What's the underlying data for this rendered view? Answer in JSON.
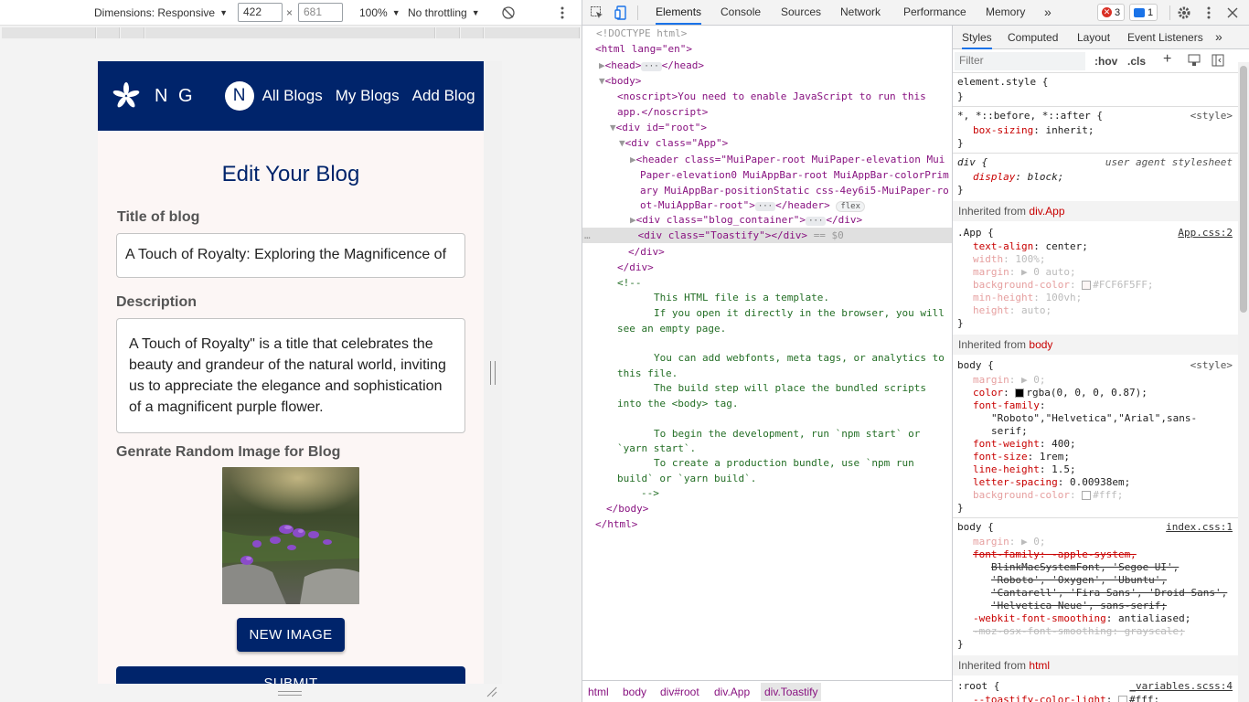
{
  "device_toolbar": {
    "dimensions_label": "Dimensions: Responsive",
    "width": "422",
    "height": "681",
    "zoom": "100%",
    "throttling": "No throttling",
    "times": "×"
  },
  "app": {
    "brand": "N G",
    "avatar_letter": "N",
    "nav": {
      "all": "All Blogs",
      "mine": "My Blogs",
      "add": "Add Blog"
    },
    "page_title": "Edit Your Blog",
    "title_label": "Title of blog",
    "title_value": "A Touch of Royalty: Exploring the Magnificence of",
    "description_label": "Description",
    "description_value": "A Touch of Royalty\" is a title that celebrates the beauty and grandeur of the natural world, inviting us to appreciate the elegance and sophistication of a magnificent purple flower.",
    "image_label": "Genrate Random Image for Blog",
    "new_image_button": "NEW IMAGE",
    "submit_button": "SUBMIT",
    "header_color": "#00246B",
    "background_color": "#FCF6F5"
  },
  "devtools": {
    "tabs": [
      "Elements",
      "Console",
      "Sources",
      "Network",
      "Performance",
      "Memory",
      "»"
    ],
    "errors_count": "3",
    "messages_count": "1"
  },
  "elements": {
    "lines": [
      "<!DOCTYPE html>",
      "<html lang=\"en\">",
      "<head>",
      "</head>",
      "<body>",
      "<noscript>You need to enable JavaScript to run this",
      "app.</noscript>",
      "<div id=\"root\">",
      "<div class=\"App\">",
      "<header class=\"MuiPaper-root MuiPaper-elevation Mui",
      "Paper-elevation0 MuiAppBar-root MuiAppBar-colorPrim",
      "ary MuiAppBar-positionStatic css-4ey6i5-MuiPaper-ro",
      "ot-MuiAppBar-root\">",
      "</header>",
      "flex",
      "<div class=\"blog_container\">",
      "</div>",
      "<div class=\"Toastify\"></div>",
      "== $0",
      "</div>",
      "</div>",
      "<!--",
      "This HTML file is a template.",
      "If you open it directly in the browser, you will",
      "see an empty page.",
      "You can add webfonts, meta tags, or analytics to",
      "this file.",
      "The build step will place the bundled scripts",
      "into the <body> tag.",
      "To begin the development, run `npm start` or",
      "`yarn start`.",
      "To create a production bundle, use `npm run",
      "build` or `yarn build`.",
      "-->",
      "</body>",
      "</html>"
    ],
    "ellipsis": "…",
    "dots": "···"
  },
  "breadcrumbs": [
    "html",
    "body",
    "div#root",
    "div.App",
    "div.Toastify"
  ],
  "styles": {
    "tabs": [
      "Styles",
      "Computed",
      "Layout",
      "Event Listeners",
      "»"
    ],
    "filter_placeholder": "Filter",
    "hov": ":hov",
    "cls": ".cls",
    "rules": {
      "element_style": "element.style {",
      "close": "}",
      "universal_selector": "*, *::before, *::after {",
      "universal_src": "<style>",
      "box_sizing": "box-sizing",
      "inherit": "inherit;",
      "div_selector": "div {",
      "div_src": "user agent stylesheet",
      "display": "display",
      "block": "block;",
      "inherited_from": "Inherited from",
      "div_app": "div.App",
      "app_selector": ".App {",
      "app_src": "App.css:2",
      "text_align": "text-align",
      "center": "center;",
      "width": "width",
      "width_val": "100%;",
      "margin": "margin",
      "margin_auto": "0 auto;",
      "background_color": "background-color",
      "bg_val": "#FCF6F5FF;",
      "min_height": "min-height",
      "min_height_val": "100vh;",
      "height": "height",
      "height_val": "auto;",
      "body_label": "body",
      "body_selector": "body {",
      "body_src": "<style>",
      "margin_zero": "0;",
      "color": "color",
      "color_val": "rgba(0, 0, 0, 0.87);",
      "font_family": "font-family",
      "font_family_val1": "\"Roboto\",\"Helvetica\",\"Arial\",sans-",
      "font_family_val2": "serif;",
      "font_weight": "font-weight",
      "font_weight_val": "400;",
      "font_size": "font-size",
      "font_size_val": "1rem;",
      "line_height": "line-height",
      "line_height_val": "1.5;",
      "letter_spacing": "letter-spacing",
      "letter_spacing_val": "0.00938em;",
      "bg_fff": "#fff;",
      "body2_src": "index.css:1",
      "ff_strike1": "font-family: -apple-system,",
      "ff_strike2": "BlinkMacSystemFont, 'Segoe UI',",
      "ff_strike3": "'Roboto', 'Oxygen', 'Ubuntu',",
      "ff_strike4": "'Cantarell', 'Fira Sans', 'Droid Sans',",
      "ff_strike5": "'Helvetica Neue', sans-serif;",
      "webkit_smoothing": "-webkit-font-smoothing",
      "antialiased": "antialiased;",
      "moz_smoothing": "-moz-osx-font-smoothing: grayscale;",
      "html_label": "html",
      "root_selector": ":root {",
      "root_src": "_variables.scss:4",
      "toastify_light": "--toastify-color-light",
      "toastify_val": "#fff;"
    }
  }
}
